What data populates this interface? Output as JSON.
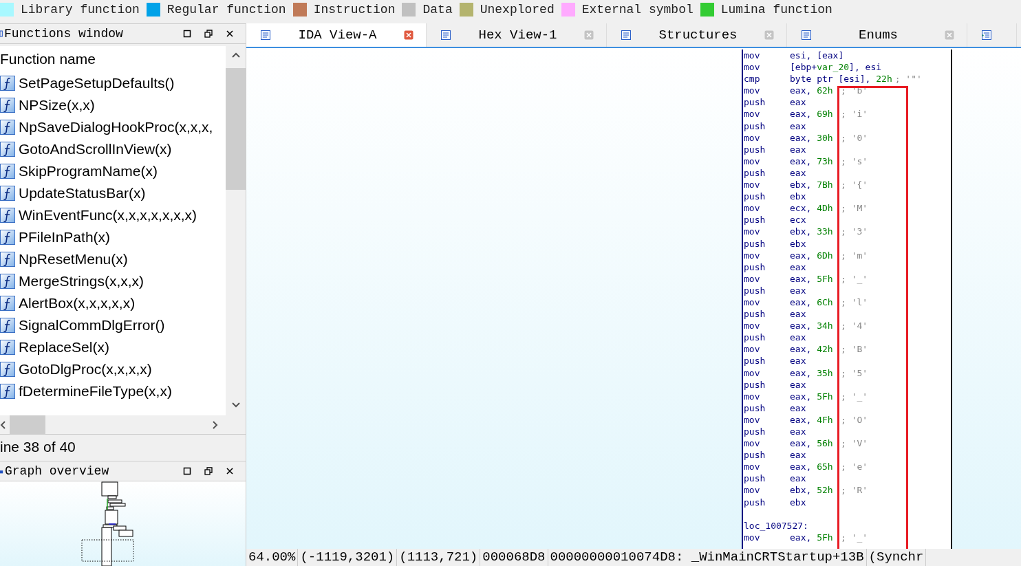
{
  "legend": [
    {
      "label": "Library function",
      "color": "#a8f8ff"
    },
    {
      "label": "Regular function",
      "color": "#00a2e8"
    },
    {
      "label": "Instruction",
      "color": "#c07a58"
    },
    {
      "label": "Data",
      "color": "#c0c0c0"
    },
    {
      "label": "Unexplored",
      "color": "#b4b46e"
    },
    {
      "label": "External symbol",
      "color": "#ffaaff"
    },
    {
      "label": "Lumina function",
      "color": "#33cc33"
    }
  ],
  "functions_window": {
    "title": "Functions window",
    "column": "Function name",
    "functions": [
      "SetPageSetupDefaults()",
      "NPSize(x,x)",
      "NpSaveDialogHookProc(x,x,x,",
      "GotoAndScrollInView(x)",
      "SkipProgramName(x)",
      "UpdateStatusBar(x)",
      "WinEventFunc(x,x,x,x,x,x,x)",
      "PFileInPath(x)",
      "NpResetMenu(x)",
      "MergeStrings(x,x,x)",
      "AlertBox(x,x,x,x,x)",
      "SignalCommDlgError()",
      "ReplaceSel(x)",
      "GotoDlgProc(x,x,x,x)",
      "fDetermineFileType(x,x)"
    ],
    "status": "ine 38 of 40"
  },
  "graph_overview": {
    "title": "Graph overview"
  },
  "tabs": [
    {
      "label": "IDA View-A",
      "selected": true
    },
    {
      "label": "Hex View-1",
      "selected": false
    },
    {
      "label": "Structures",
      "selected": false
    },
    {
      "label": "Enums",
      "selected": false
    }
  ],
  "asm": [
    {
      "kind": "insn",
      "mnemonic": "mov",
      "operand": [
        {
          "text": "esi, [eax]",
          "kind": "reg"
        }
      ]
    },
    {
      "kind": "insn",
      "mnemonic": "mov",
      "operand": [
        {
          "text": "[ebp+",
          "kind": "reg"
        },
        {
          "text": "var_20",
          "kind": "num"
        },
        {
          "text": "], esi",
          "kind": "reg"
        }
      ]
    },
    {
      "kind": "insn",
      "mnemonic": "cmp",
      "operand": [
        {
          "text": "byte ptr [esi], ",
          "kind": "reg"
        },
        {
          "text": "22h",
          "kind": "num"
        }
      ],
      "comment": "; '\"'"
    },
    {
      "kind": "insn",
      "mnemonic": "mov",
      "operand": [
        {
          "text": "eax, ",
          "kind": "reg"
        },
        {
          "text": "62h",
          "kind": "num"
        }
      ],
      "comment": "; 'b'"
    },
    {
      "kind": "insn",
      "mnemonic": "push",
      "operand": [
        {
          "text": "eax",
          "kind": "reg"
        }
      ]
    },
    {
      "kind": "insn",
      "mnemonic": "mov",
      "operand": [
        {
          "text": "eax, ",
          "kind": "reg"
        },
        {
          "text": "69h",
          "kind": "num"
        }
      ],
      "comment": "; 'i'"
    },
    {
      "kind": "insn",
      "mnemonic": "push",
      "operand": [
        {
          "text": "eax",
          "kind": "reg"
        }
      ]
    },
    {
      "kind": "insn",
      "mnemonic": "mov",
      "operand": [
        {
          "text": "eax, ",
          "kind": "reg"
        },
        {
          "text": "30h",
          "kind": "num"
        }
      ],
      "comment": "; '0'"
    },
    {
      "kind": "insn",
      "mnemonic": "push",
      "operand": [
        {
          "text": "eax",
          "kind": "reg"
        }
      ]
    },
    {
      "kind": "insn",
      "mnemonic": "mov",
      "operand": [
        {
          "text": "eax, ",
          "kind": "reg"
        },
        {
          "text": "73h",
          "kind": "num"
        }
      ],
      "comment": "; 's'"
    },
    {
      "kind": "insn",
      "mnemonic": "push",
      "operand": [
        {
          "text": "eax",
          "kind": "reg"
        }
      ]
    },
    {
      "kind": "insn",
      "mnemonic": "mov",
      "operand": [
        {
          "text": "ebx, ",
          "kind": "reg"
        },
        {
          "text": "7Bh",
          "kind": "num"
        }
      ],
      "comment": "; '{'"
    },
    {
      "kind": "insn",
      "mnemonic": "push",
      "operand": [
        {
          "text": "ebx",
          "kind": "reg"
        }
      ]
    },
    {
      "kind": "insn",
      "mnemonic": "mov",
      "operand": [
        {
          "text": "ecx, ",
          "kind": "reg"
        },
        {
          "text": "4Dh",
          "kind": "num"
        }
      ],
      "comment": "; 'M'"
    },
    {
      "kind": "insn",
      "mnemonic": "push",
      "operand": [
        {
          "text": "ecx",
          "kind": "reg"
        }
      ]
    },
    {
      "kind": "insn",
      "mnemonic": "mov",
      "operand": [
        {
          "text": "ebx, ",
          "kind": "reg"
        },
        {
          "text": "33h",
          "kind": "num"
        }
      ],
      "comment": "; '3'"
    },
    {
      "kind": "insn",
      "mnemonic": "push",
      "operand": [
        {
          "text": "ebx",
          "kind": "reg"
        }
      ]
    },
    {
      "kind": "insn",
      "mnemonic": "mov",
      "operand": [
        {
          "text": "eax, ",
          "kind": "reg"
        },
        {
          "text": "6Dh",
          "kind": "num"
        }
      ],
      "comment": "; 'm'"
    },
    {
      "kind": "insn",
      "mnemonic": "push",
      "operand": [
        {
          "text": "eax",
          "kind": "reg"
        }
      ]
    },
    {
      "kind": "insn",
      "mnemonic": "mov",
      "operand": [
        {
          "text": "eax, ",
          "kind": "reg"
        },
        {
          "text": "5Fh",
          "kind": "num"
        }
      ],
      "comment": "; '_'"
    },
    {
      "kind": "insn",
      "mnemonic": "push",
      "operand": [
        {
          "text": "eax",
          "kind": "reg"
        }
      ]
    },
    {
      "kind": "insn",
      "mnemonic": "mov",
      "operand": [
        {
          "text": "eax, ",
          "kind": "reg"
        },
        {
          "text": "6Ch",
          "kind": "num"
        }
      ],
      "comment": "; 'l'"
    },
    {
      "kind": "insn",
      "mnemonic": "push",
      "operand": [
        {
          "text": "eax",
          "kind": "reg"
        }
      ]
    },
    {
      "kind": "insn",
      "mnemonic": "mov",
      "operand": [
        {
          "text": "eax, ",
          "kind": "reg"
        },
        {
          "text": "34h",
          "kind": "num"
        }
      ],
      "comment": "; '4'"
    },
    {
      "kind": "insn",
      "mnemonic": "push",
      "operand": [
        {
          "text": "eax",
          "kind": "reg"
        }
      ]
    },
    {
      "kind": "insn",
      "mnemonic": "mov",
      "operand": [
        {
          "text": "eax, ",
          "kind": "reg"
        },
        {
          "text": "42h",
          "kind": "num"
        }
      ],
      "comment": "; 'B'"
    },
    {
      "kind": "insn",
      "mnemonic": "push",
      "operand": [
        {
          "text": "eax",
          "kind": "reg"
        }
      ]
    },
    {
      "kind": "insn",
      "mnemonic": "mov",
      "operand": [
        {
          "text": "eax, ",
          "kind": "reg"
        },
        {
          "text": "35h",
          "kind": "num"
        }
      ],
      "comment": "; '5'"
    },
    {
      "kind": "insn",
      "mnemonic": "push",
      "operand": [
        {
          "text": "eax",
          "kind": "reg"
        }
      ]
    },
    {
      "kind": "insn",
      "mnemonic": "mov",
      "operand": [
        {
          "text": "eax, ",
          "kind": "reg"
        },
        {
          "text": "5Fh",
          "kind": "num"
        }
      ],
      "comment": "; '_'"
    },
    {
      "kind": "insn",
      "mnemonic": "push",
      "operand": [
        {
          "text": "eax",
          "kind": "reg"
        }
      ]
    },
    {
      "kind": "insn",
      "mnemonic": "mov",
      "operand": [
        {
          "text": "eax, ",
          "kind": "reg"
        },
        {
          "text": "4Fh",
          "kind": "num"
        }
      ],
      "comment": "; 'O'"
    },
    {
      "kind": "insn",
      "mnemonic": "push",
      "operand": [
        {
          "text": "eax",
          "kind": "reg"
        }
      ]
    },
    {
      "kind": "insn",
      "mnemonic": "mov",
      "operand": [
        {
          "text": "eax, ",
          "kind": "reg"
        },
        {
          "text": "56h",
          "kind": "num"
        }
      ],
      "comment": "; 'V'"
    },
    {
      "kind": "insn",
      "mnemonic": "push",
      "operand": [
        {
          "text": "eax",
          "kind": "reg"
        }
      ]
    },
    {
      "kind": "insn",
      "mnemonic": "mov",
      "operand": [
        {
          "text": "eax, ",
          "kind": "reg"
        },
        {
          "text": "65h",
          "kind": "num"
        }
      ],
      "comment": "; 'e'"
    },
    {
      "kind": "insn",
      "mnemonic": "push",
      "operand": [
        {
          "text": "eax",
          "kind": "reg"
        }
      ]
    },
    {
      "kind": "insn",
      "mnemonic": "mov",
      "operand": [
        {
          "text": "ebx, ",
          "kind": "reg"
        },
        {
          "text": "52h",
          "kind": "num"
        }
      ],
      "comment": "; 'R'"
    },
    {
      "kind": "insn",
      "mnemonic": "push",
      "operand": [
        {
          "text": "ebx",
          "kind": "reg"
        }
      ]
    },
    {
      "kind": "blank"
    },
    {
      "kind": "label",
      "text": "loc_1007527:"
    },
    {
      "kind": "insn",
      "mnemonic": "mov",
      "operand": [
        {
          "text": "eax, ",
          "kind": "reg"
        },
        {
          "text": "5Fh",
          "kind": "num"
        }
      ],
      "comment": "; '_'"
    }
  ],
  "status_bar": [
    "64.00%",
    "(-1119,3201)",
    "(1113,721)",
    "000068D8",
    "00000000010074D8: _WinMainCRTStartup+13B",
    "(Synchr"
  ]
}
